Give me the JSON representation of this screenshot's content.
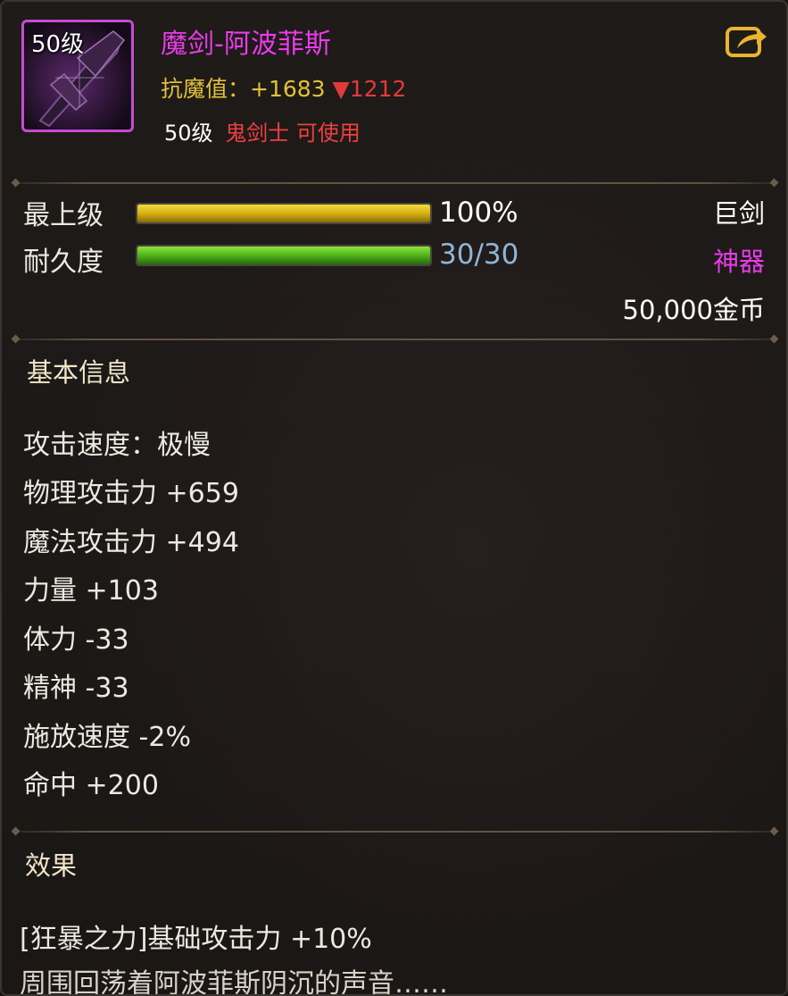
{
  "item": {
    "icon_level": "50级",
    "name": "魔剑-阿波菲斯",
    "anti_magic_label": "抗魔值：",
    "anti_magic_value": "+1683",
    "anti_magic_compare": "▼1212",
    "required_level": "50级",
    "usable_by": "鬼剑士 可使用"
  },
  "grade": {
    "label": "最上级",
    "percent": 100,
    "text": "100%"
  },
  "durability": {
    "label": "耐久度",
    "current": 30,
    "max": 30,
    "text": "30/30"
  },
  "item_type": "巨剑",
  "rarity": "神器",
  "price": "50,000金币",
  "colors": {
    "rarity_epic": "#e83ce8",
    "gold": "#e2c13a",
    "red": "#ee4040",
    "durability_text": "#8fb5d8"
  },
  "basic_info": {
    "title": "基本信息",
    "attributes": [
      "攻击速度：极慢",
      "物理攻击力 +659",
      "魔法攻击力 +494",
      "力量 +103",
      "体力 -33",
      "精神 -33",
      "施放速度 -2%",
      "命中 +200"
    ]
  },
  "effects": {
    "title": "效果",
    "lines": [
      "[狂暴之力]基础攻击力 +10%",
      "周围回荡着阿波菲斯阴沉的声音……"
    ]
  },
  "icons": {
    "share": "share-arrow-icon",
    "item": "sword-icon"
  }
}
